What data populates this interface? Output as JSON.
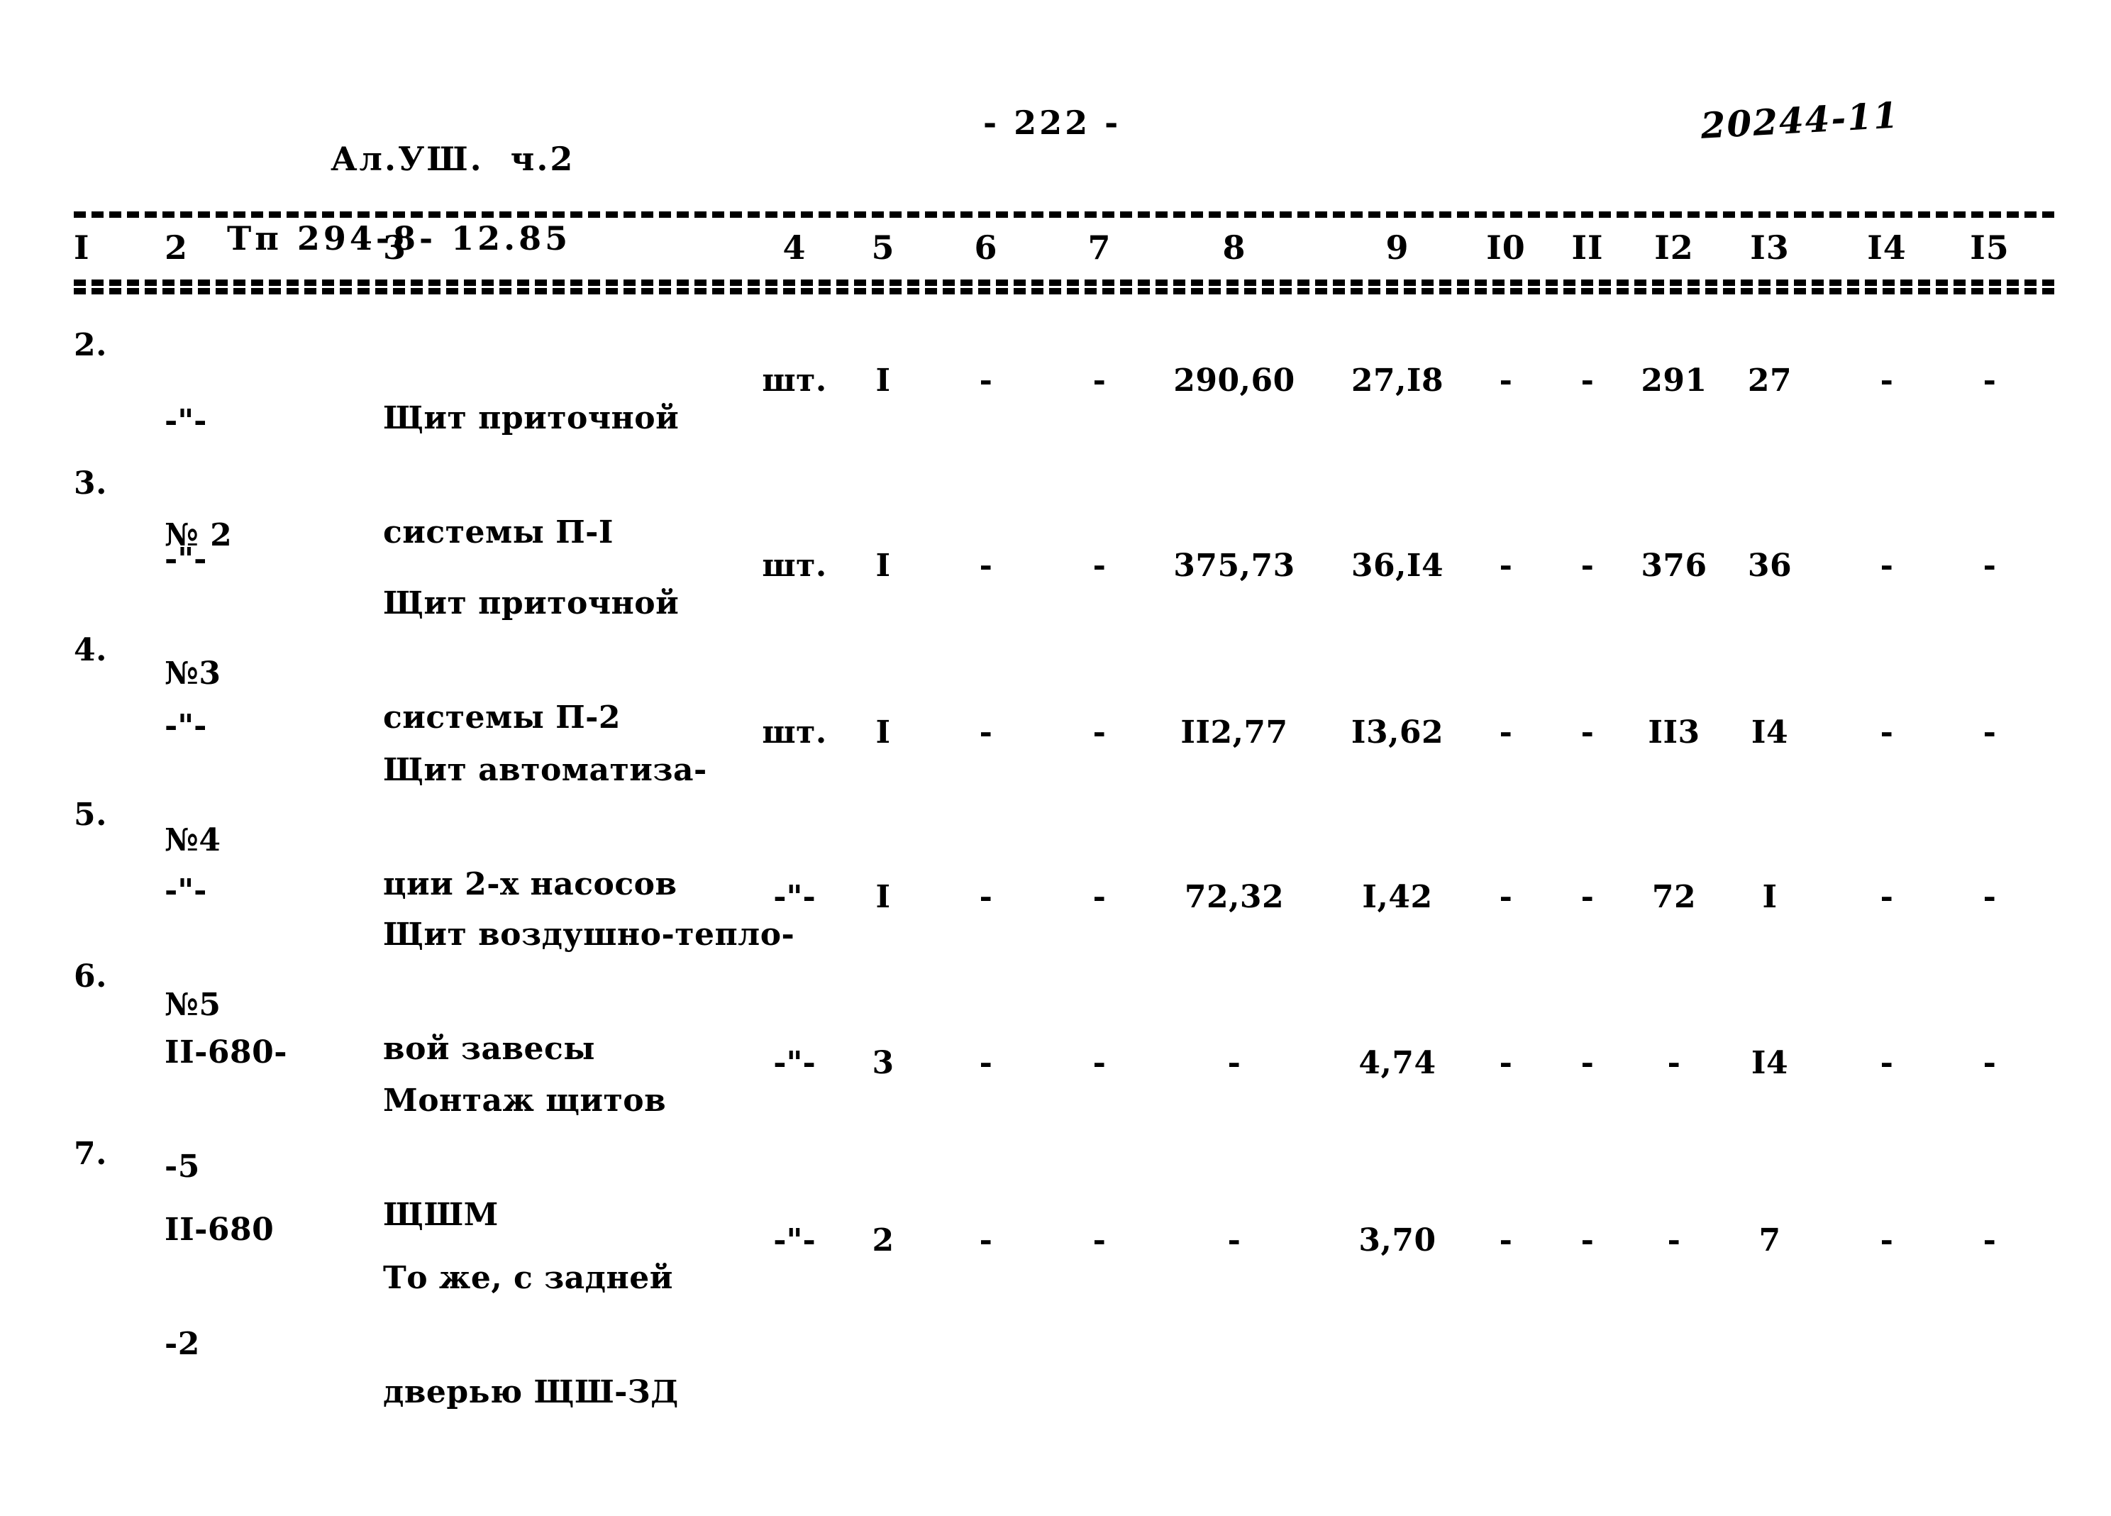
{
  "header": {
    "album_line1": "Ал.УШ.  ч.2",
    "album_line2": "Тп 294-8- 12.85",
    "page_number": "- 222 -",
    "stamp_code": "20244-11"
  },
  "table": {
    "column_headers": [
      "I",
      "2",
      "3",
      "4",
      "5",
      "6",
      "7",
      "8",
      "9",
      "I0",
      "II",
      "I2",
      "I3",
      "I4",
      "I5"
    ],
    "rows": [
      {
        "no": "2.",
        "code_top": "-\"-",
        "code_bot": "№ 2",
        "name_top": "Щит приточной",
        "name_bot": "системы П-I",
        "unit": "шт.",
        "c5": "I",
        "c6": "-",
        "c7": "-",
        "c8": "290,60",
        "c9": "27,I8",
        "c10": "-",
        "c11": "-",
        "c12": "291",
        "c13": "27",
        "c14": "-",
        "c15": "-"
      },
      {
        "no": "3.",
        "code_top": "-\"-",
        "code_bot": "№3",
        "name_top": "Щит приточной",
        "name_bot": "системы П-2",
        "unit": "шт.",
        "c5": "I",
        "c6": "-",
        "c7": "-",
        "c8": "375,73",
        "c9": "36,I4",
        "c10": "-",
        "c11": "-",
        "c12": "376",
        "c13": "36",
        "c14": "-",
        "c15": "-"
      },
      {
        "no": "4.",
        "code_top": "-\"-",
        "code_bot": "№4",
        "name_top": "Щит автоматиза-",
        "name_bot": "ции 2-х насосов",
        "unit": "шт.",
        "c5": "I",
        "c6": "-",
        "c7": "-",
        "c8": "II2,77",
        "c9": "I3,62",
        "c10": "-",
        "c11": "-",
        "c12": "II3",
        "c13": "I4",
        "c14": "-",
        "c15": "-"
      },
      {
        "no": "5.",
        "code_top": "-\"-",
        "code_bot": "№5",
        "name_top": "Щит воздушно-тепло-",
        "name_bot": "вой завесы",
        "unit": "-\"-",
        "c5": "I",
        "c6": "-",
        "c7": "-",
        "c8": "72,32",
        "c9": "I,42",
        "c10": "-",
        "c11": "-",
        "c12": "72",
        "c13": "I",
        "c14": "-",
        "c15": "-"
      },
      {
        "no": "6.",
        "code_top": "II-680-",
        "code_bot": "-5",
        "name_top": "Монтаж щитов",
        "name_bot": "ЩШМ",
        "unit": "-\"-",
        "c5": "3",
        "c6": "-",
        "c7": "-",
        "c8": "-",
        "c9": "4,74",
        "c10": "-",
        "c11": "-",
        "c12": "-",
        "c13": "I4",
        "c14": "-",
        "c15": "-"
      },
      {
        "no": "7.",
        "code_top": "II-680",
        "code_bot": "-2",
        "name_top": "То же, с задней",
        "name_bot": "дверью ЩШ-ЗД",
        "unit": "-\"-",
        "c5": "2",
        "c6": "-",
        "c7": "-",
        "c8": "-",
        "c9": "3,70",
        "c10": "-",
        "c11": "-",
        "c12": "-",
        "c13": "7",
        "c14": "-",
        "c15": "-"
      }
    ]
  }
}
